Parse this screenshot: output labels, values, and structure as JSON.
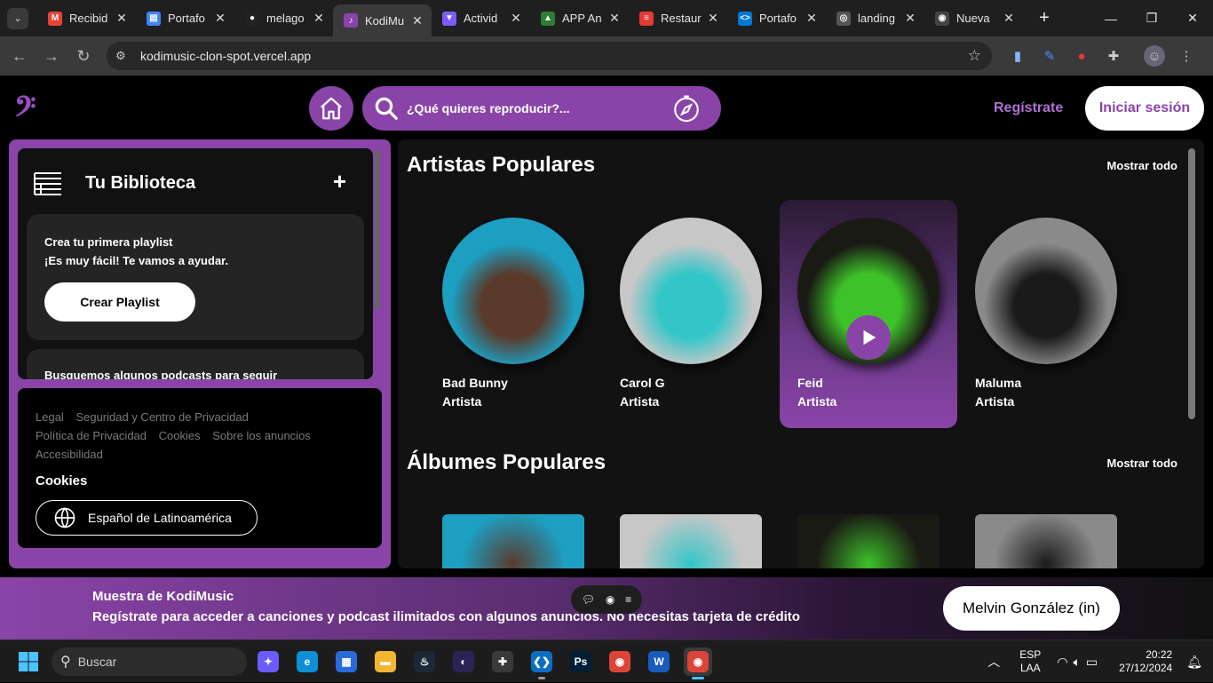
{
  "browser": {
    "tabs": [
      {
        "title": "Recibid",
        "icon": "gmail-icon",
        "color": "#ea4335",
        "glyph": "M"
      },
      {
        "title": "Portafo",
        "icon": "docs-icon",
        "color": "#4285f4",
        "glyph": "▤"
      },
      {
        "title": "melago",
        "icon": "github-icon",
        "color": "#222222",
        "glyph": "●"
      },
      {
        "title": "KodiMu",
        "icon": "kodimusic-icon",
        "color": "#8a44a8",
        "glyph": "♪"
      },
      {
        "title": "Activid",
        "icon": "vite-icon",
        "color": "#7c5cff",
        "glyph": "▼"
      },
      {
        "title": "APP An",
        "icon": "app-icon",
        "color": "#2e7d32",
        "glyph": "▲"
      },
      {
        "title": "Restaur",
        "icon": "restaurant-icon",
        "color": "#e53935",
        "glyph": "≡"
      },
      {
        "title": "Portafo",
        "icon": "vscode-tab-icon",
        "color": "#0078d4",
        "glyph": "<>"
      },
      {
        "title": "landing",
        "icon": "globe-icon",
        "color": "#555555",
        "glyph": "◎"
      },
      {
        "title": "Nueva",
        "icon": "chrome-icon",
        "color": "#444444",
        "glyph": "◉"
      }
    ],
    "active_tab": 3,
    "url": "kodimusic-clon-spot.vercel.app"
  },
  "header": {
    "logo": "𝄢",
    "search_placeholder": "¿Qué quieres reproducir?...",
    "register_label": "Regístrate",
    "login_label": "Iniciar sesión"
  },
  "library": {
    "title": "Tu Biblioteca",
    "add": "+",
    "playlist_card": {
      "line1": "Crea tu primera playlist",
      "line2": "¡Es muy fácil! Te vamos a ayudar.",
      "button": "Crear Playlist"
    },
    "podcast_card": {
      "line1": "Busquemos algunos podcasts para seguir"
    }
  },
  "footer": {
    "links": [
      "Legal",
      "Seguridad y Centro de Privacidad",
      "Política de Privacidad",
      "Cookies",
      "Sobre los anuncios",
      "Accesibilidad"
    ],
    "cookies": "Cookies",
    "language": "Español de Latinoamérica"
  },
  "main": {
    "artists_title": "Artistas Populares",
    "albums_title": "Álbumes Populares",
    "show_all": "Mostrar todo",
    "artists": [
      {
        "name": "Bad Bunny",
        "role": "Artista",
        "bg": "#1d9fc2",
        "fg": "#5a3a2a"
      },
      {
        "name": "Carol G",
        "role": "Artista",
        "bg": "#c7c7c7",
        "fg": "#32c6c8"
      },
      {
        "name": "Feid",
        "role": "Artista",
        "bg": "#1a1a14",
        "fg": "#3ec22a"
      },
      {
        "name": "Maluma",
        "role": "Artista",
        "bg": "#8a8a8a",
        "fg": "#1a1a1a"
      }
    ],
    "highlighted_artist": 2
  },
  "banner": {
    "line1": "Muestra de KodiMusic",
    "line2": "Regístrate para acceder a canciones y podcast ilimitados con algunos anuncios. No necesitas tarjeta de crédito",
    "button": "Melvin González (in)"
  },
  "taskbar": {
    "search": "Buscar",
    "apps": [
      {
        "icon": "copilot-icon",
        "color": "#6b5cff",
        "glyph": "✦"
      },
      {
        "icon": "edge-icon",
        "color": "#0f8fd6",
        "glyph": "e"
      },
      {
        "icon": "store-icon",
        "color": "#2b6ad8",
        "glyph": "▦"
      },
      {
        "icon": "file-explorer-icon",
        "color": "#f2b632",
        "glyph": "▬"
      },
      {
        "icon": "steam-icon",
        "color": "#1b2838",
        "glyph": "♨"
      },
      {
        "icon": "eclipse-icon",
        "color": "#2c2255",
        "glyph": "◐"
      },
      {
        "icon": "slack-icon",
        "color": "#3a3a3a",
        "glyph": "✚"
      },
      {
        "icon": "vscode-icon",
        "color": "#0a6fc2",
        "glyph": "❮❯"
      },
      {
        "icon": "photoshop-icon",
        "color": "#001e36",
        "glyph": "Ps"
      },
      {
        "icon": "chrome-taskbar-icon",
        "color": "#db4437",
        "glyph": "◉"
      },
      {
        "icon": "word-icon",
        "color": "#185abd",
        "glyph": "W"
      },
      {
        "icon": "chrome-active-icon",
        "color": "#db4437",
        "glyph": "◉"
      }
    ],
    "active_app": 11,
    "lang_line1": "ESP",
    "lang_line2": "LAA",
    "time": "20:22",
    "date": "27/12/2024"
  }
}
